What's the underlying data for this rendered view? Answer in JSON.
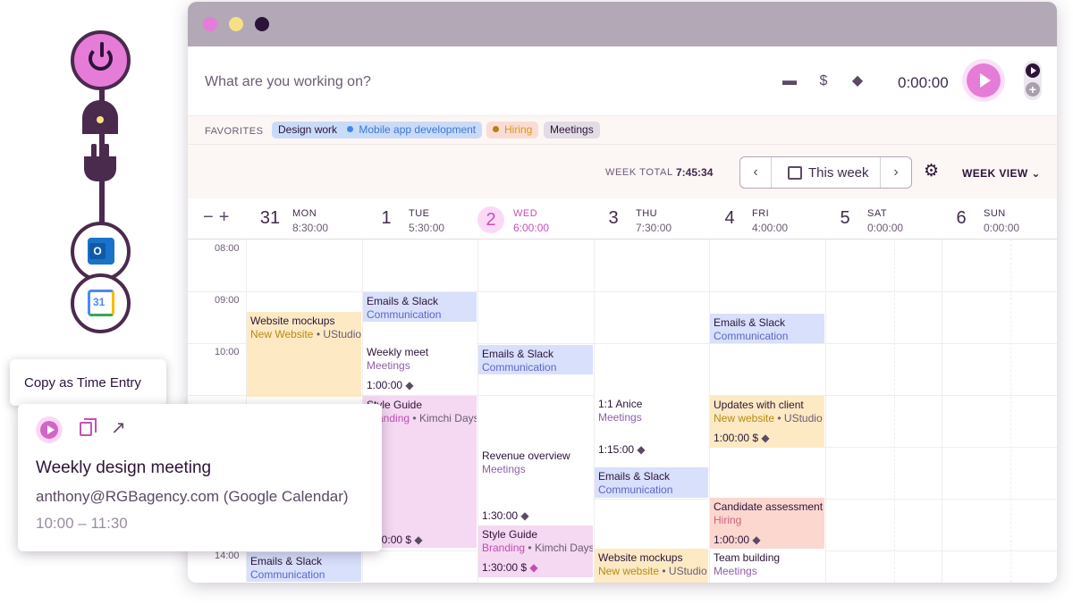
{
  "timer": {
    "placeholder": "What are you working on?",
    "value": "0:00:00"
  },
  "favorites": {
    "label": "FAVORITES",
    "items": [
      {
        "label": "Design work",
        "color": "#c9dbf7"
      },
      {
        "label": "Mobile app development",
        "color": "#4285f4"
      },
      {
        "label": "Hiring",
        "color": "#d59b1b"
      },
      {
        "label": "Meetings",
        "color": "#e2dde4"
      }
    ]
  },
  "week": {
    "total_label": "WEEK TOTAL",
    "total_value": "7:45:34",
    "range_label": "This week",
    "view_label": "WEEK VIEW"
  },
  "days": [
    {
      "num": "31",
      "name": "MON",
      "total": "8:30:00"
    },
    {
      "num": "1",
      "name": "TUE",
      "total": "5:30:00"
    },
    {
      "num": "2",
      "name": "WED",
      "total": "6:00:00",
      "today": true
    },
    {
      "num": "3",
      "name": "THU",
      "total": "7:30:00"
    },
    {
      "num": "4",
      "name": "FRI",
      "total": "4:00:00"
    },
    {
      "num": "5",
      "name": "SAT",
      "total": "0:00:00"
    },
    {
      "num": "6",
      "name": "SUN",
      "total": "0:00:00"
    }
  ],
  "hours": [
    "08:00",
    "09:00",
    "10:00",
    "14:00"
  ],
  "events": [
    {
      "title": "Website mockups",
      "project": "New Website",
      "client": "UStudio",
      "duration": ""
    },
    {
      "title": "Emails & Slack",
      "project": "Communication",
      "client": "",
      "duration": ""
    },
    {
      "title": "Weekly meet",
      "project": "Meetings",
      "client": "",
      "duration": "1:00:00"
    },
    {
      "title": "Style Guide",
      "project": "Branding",
      "client": "Kimchi Days",
      "duration": "1:00:00"
    },
    {
      "title": "Emails & Slack",
      "project": "Communication",
      "client": "",
      "duration": ""
    },
    {
      "title": "Revenue overview",
      "project": "Meetings",
      "client": "",
      "duration": "1:30:00"
    },
    {
      "title": "Style Guide",
      "project": "Branding",
      "client": "Kimchi Days",
      "duration": "1:30:00"
    },
    {
      "title": "1:1 Anice",
      "project": "Meetings",
      "client": "",
      "duration": "1:15:00"
    },
    {
      "title": "Emails & Slack",
      "project": "Communication",
      "client": "",
      "duration": ""
    },
    {
      "title": "Website mockups",
      "project": "New website",
      "client": "UStudio",
      "duration": ""
    },
    {
      "title": "Emails & Slack",
      "project": "Communication",
      "client": "",
      "duration": ""
    },
    {
      "title": "Updates with client",
      "project": "New website",
      "client": "UStudio",
      "duration": "1:00:00"
    },
    {
      "title": "Candidate assessment",
      "project": "Hiring",
      "client": "",
      "duration": "1:00:00"
    },
    {
      "title": "Team building",
      "project": "Meetings",
      "client": "",
      "duration": ""
    },
    {
      "title": "Emails & Slack",
      "project": "Communication",
      "client": "",
      "duration": ""
    }
  ],
  "tooltip": {
    "label": "Copy as Time Entry"
  },
  "popup": {
    "title": "Weekly design meeting",
    "source": "anthony@RGBagency.com (Google Calendar)",
    "time": "10:00 – 11:30"
  },
  "integrations": {
    "calendar_day": "31",
    "outlook_letter": "O"
  }
}
